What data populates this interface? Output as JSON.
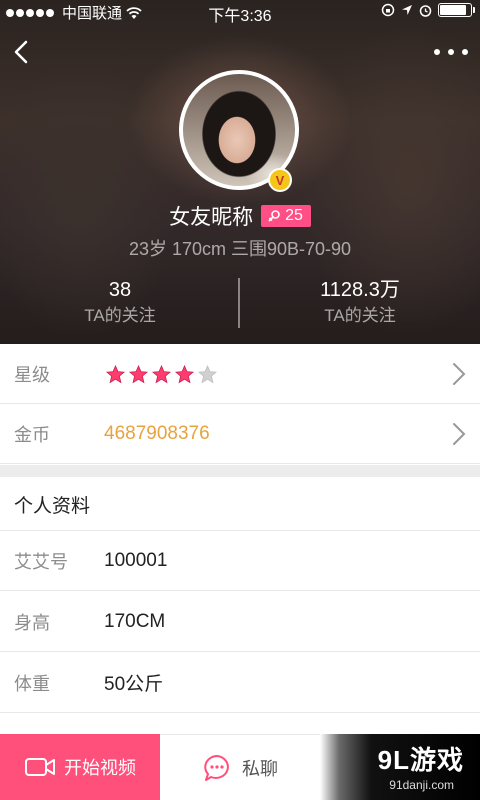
{
  "status_bar": {
    "carrier": "中国联通",
    "time": "下午3:36",
    "battery_level": 0.9
  },
  "profile": {
    "nickname": "女友昵称",
    "vip_badge": "V",
    "age_badge": "25",
    "stats_line": "23岁 170cm 三围90B-70-90",
    "left_count": {
      "value": "38",
      "label": "TA的关注"
    },
    "right_count": {
      "value": "1128.3万",
      "label": "TA的关注"
    }
  },
  "rows": {
    "level": {
      "label": "星级",
      "stars_filled": 4,
      "stars_total": 5
    },
    "coins": {
      "label": "金币",
      "value": "4687908376"
    }
  },
  "personal_info": {
    "title": "个人资料",
    "items": [
      {
        "label": "艾艾号",
        "value": "100001"
      },
      {
        "label": "身高",
        "value": "170CM"
      },
      {
        "label": "体重",
        "value": "50公斤"
      }
    ]
  },
  "bottom_bar": {
    "video_label": "开始视频",
    "chat_label": "私聊"
  },
  "watermark": {
    "logo": "9L游戏",
    "url": "91danji.com"
  },
  "colors": {
    "accent_pink": "#ff4f7b",
    "badge_pink": "#ff4f86",
    "gold": "#e8a33d",
    "star_filled": "#ff3c6e",
    "star_empty": "#d0d0d0"
  },
  "icons": {
    "back": "chevron-left-icon",
    "more": "more-dots-icon",
    "video": "video-camera-icon",
    "chat": "chat-bubble-icon",
    "row_arrow": "chevron-right-icon",
    "gender": "female-icon"
  }
}
